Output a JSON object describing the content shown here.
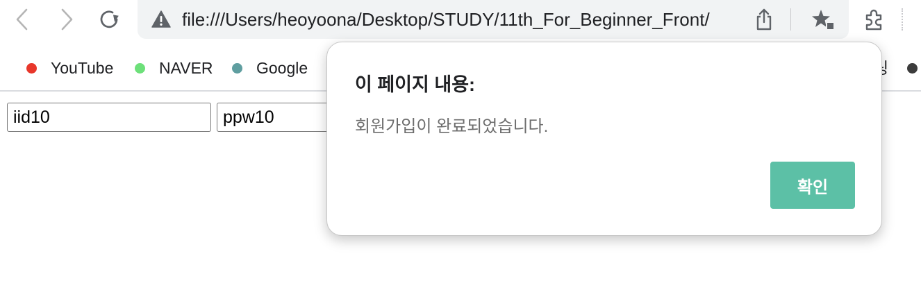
{
  "toolbar": {
    "url": "file:///Users/heoyoona/Desktop/STUDY/11th_For_Beginner_Front/"
  },
  "bookmarks": [
    {
      "label": "YouTube",
      "color": "#e8372b"
    },
    {
      "label": "NAVER",
      "color": "#6de07a"
    },
    {
      "label": "Google",
      "color": "#5f9ea0"
    },
    {
      "label": "링",
      "color": "#3c3c3c"
    }
  ],
  "form": {
    "id_value": "iid10",
    "pw_value": "ppw10"
  },
  "dialog": {
    "title": "이 페이지 내용:",
    "message": "회원가입이 완료되었습니다.",
    "confirm_label": "확인",
    "accent_color": "#5cc0a6"
  }
}
